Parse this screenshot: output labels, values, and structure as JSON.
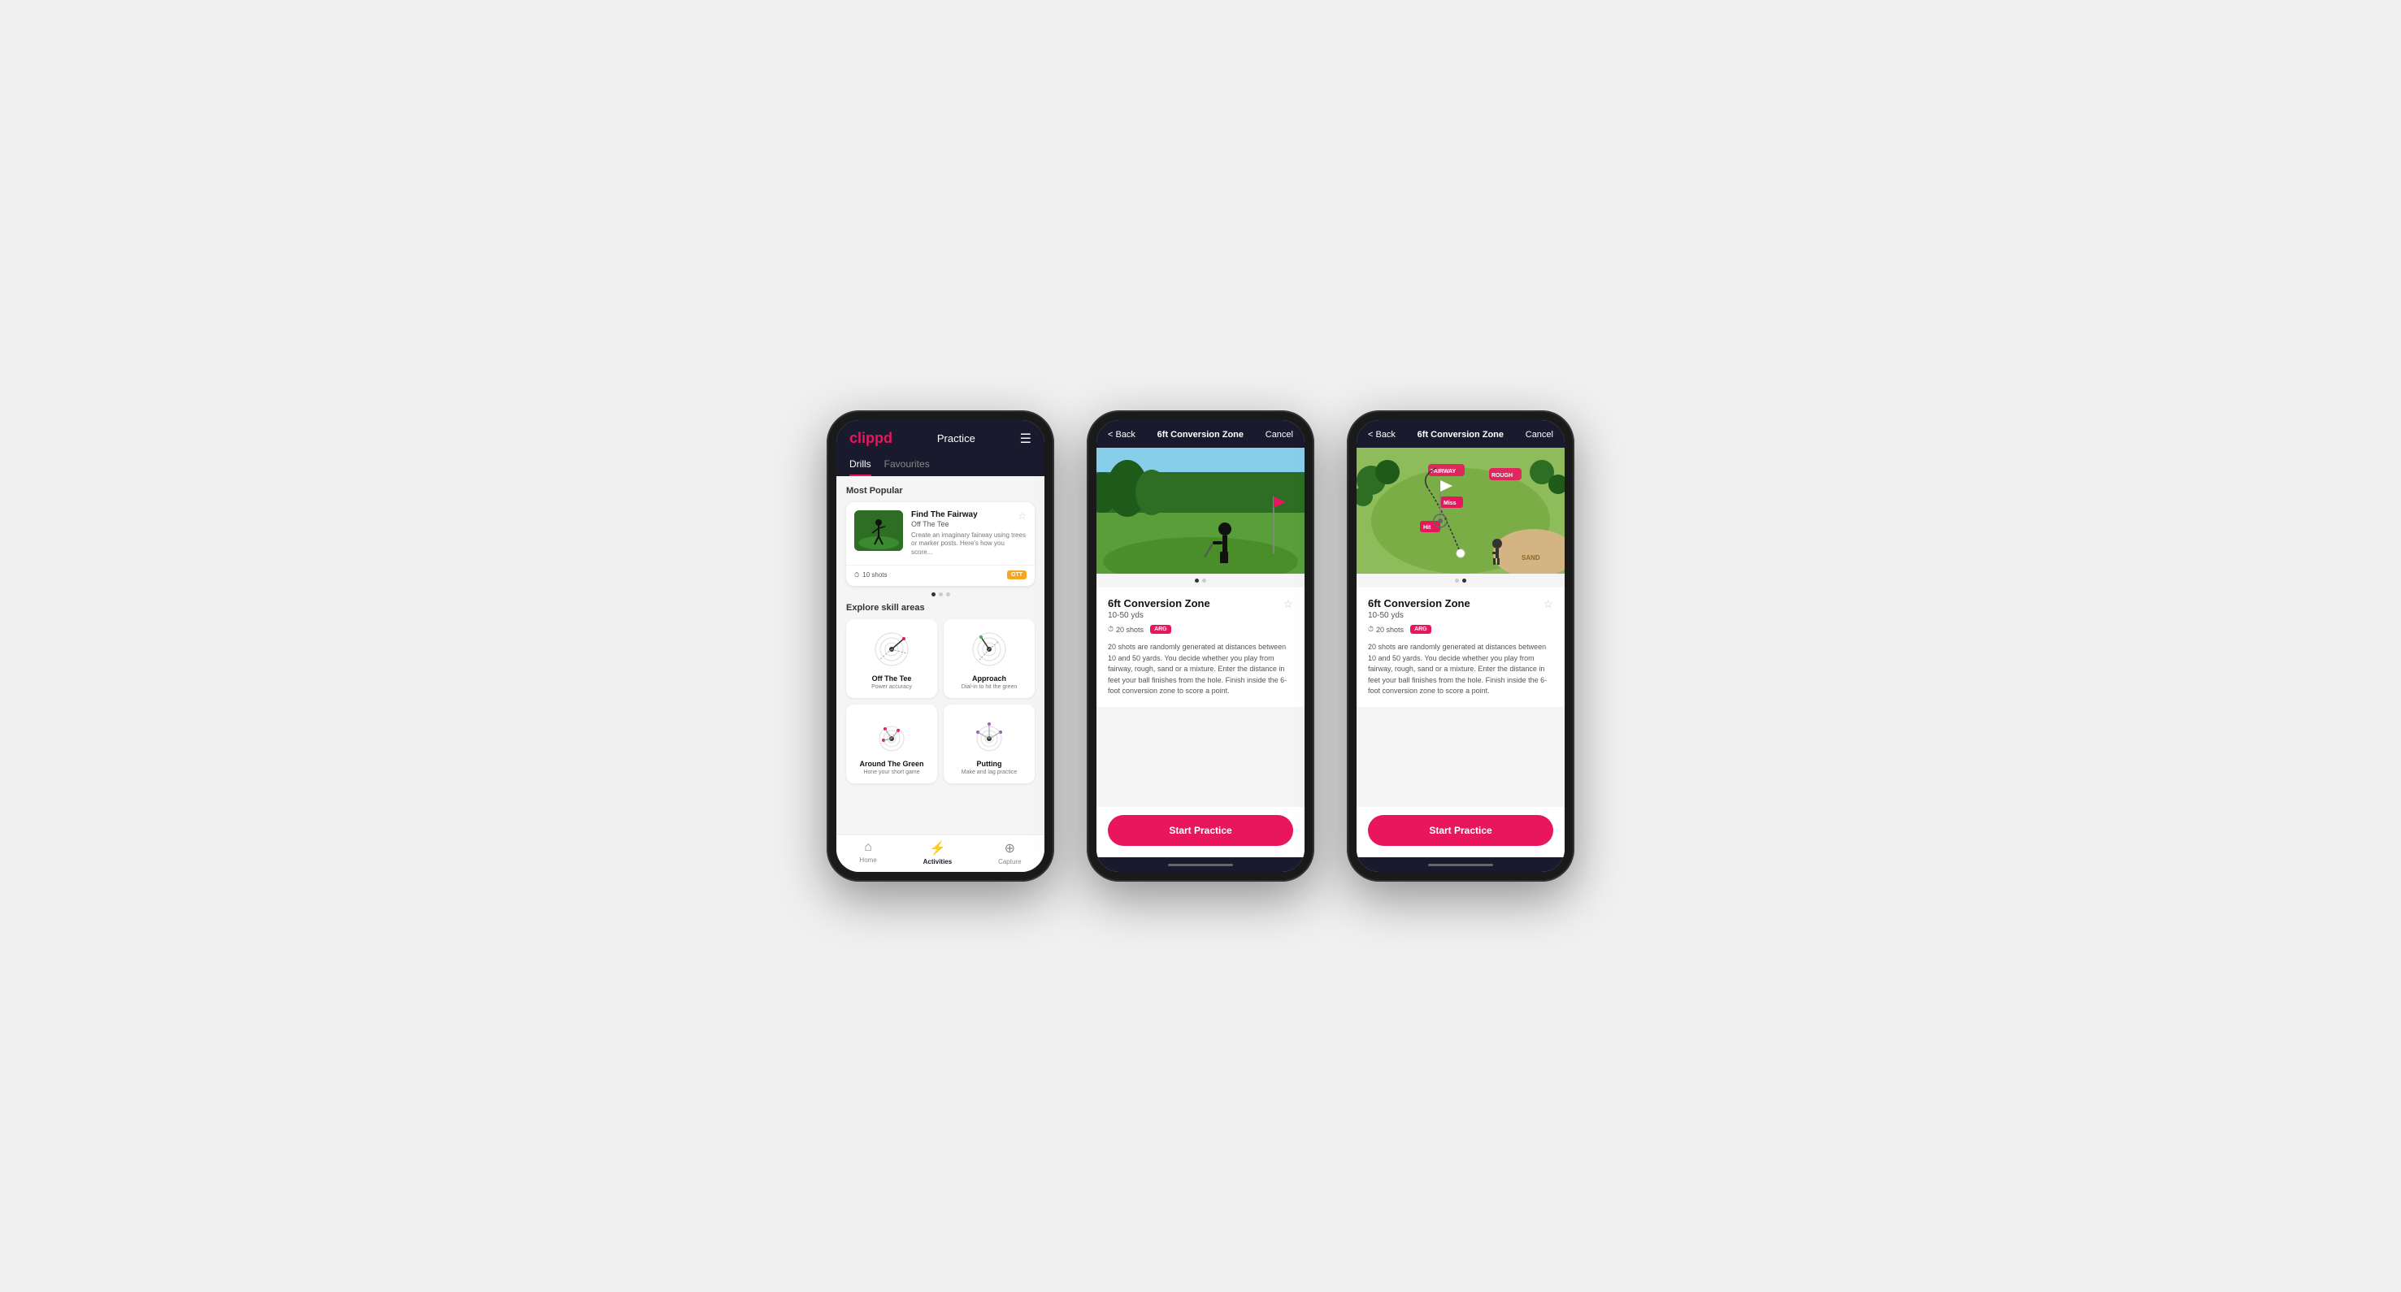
{
  "phone1": {
    "header": {
      "logo": "clippd",
      "title": "Practice",
      "menu_icon": "☰"
    },
    "tabs": [
      {
        "label": "Drills",
        "active": true
      },
      {
        "label": "Favourites",
        "active": false
      }
    ],
    "most_popular": {
      "section_title": "Most Popular",
      "card": {
        "title": "Find The Fairway",
        "subtitle": "Off The Tee",
        "description": "Create an imaginary fairway using trees or marker posts. Here's how you score...",
        "shots": "10 shots",
        "tag": "OTT"
      },
      "dots": [
        true,
        false,
        false
      ]
    },
    "explore": {
      "section_title": "Explore skill areas",
      "skills": [
        {
          "name": "Off The Tee",
          "desc": "Power accuracy",
          "icon": "ott"
        },
        {
          "name": "Approach",
          "desc": "Dial-in to hit the green",
          "icon": "approach"
        },
        {
          "name": "Around The Green",
          "desc": "Hone your short game",
          "icon": "atg"
        },
        {
          "name": "Putting",
          "desc": "Make and lag practice",
          "icon": "putting"
        }
      ]
    },
    "bottom_nav": [
      {
        "label": "Home",
        "icon": "⌂",
        "active": false
      },
      {
        "label": "Activities",
        "icon": "⚡",
        "active": true
      },
      {
        "label": "Capture",
        "icon": "⊕",
        "active": false
      }
    ]
  },
  "phone2": {
    "header": {
      "back_label": "< Back",
      "title": "6ft Conversion Zone",
      "cancel_label": "Cancel"
    },
    "drill": {
      "title": "6ft Conversion Zone",
      "subtitle": "10-50 yds",
      "shots": "20 shots",
      "tag": "ARG",
      "description": "20 shots are randomly generated at distances between 10 and 50 yards. You decide whether you play from fairway, rough, sand or a mixture. Enter the distance in feet your ball finishes from the hole. Finish inside the 6-foot conversion zone to score a point.",
      "fav_icon": "☆"
    },
    "dots": [
      true,
      false
    ],
    "start_button": "Start Practice"
  },
  "phone3": {
    "header": {
      "back_label": "< Back",
      "title": "6ft Conversion Zone",
      "cancel_label": "Cancel"
    },
    "drill": {
      "title": "6ft Conversion Zone",
      "subtitle": "10-50 yds",
      "shots": "20 shots",
      "tag": "ARG",
      "description": "20 shots are randomly generated at distances between 10 and 50 yards. You decide whether you play from fairway, rough, sand or a mixture. Enter the distance in feet your ball finishes from the hole. Finish inside the 6-foot conversion zone to score a point.",
      "fav_icon": "☆"
    },
    "dots": [
      false,
      true
    ],
    "start_button": "Start Practice"
  }
}
